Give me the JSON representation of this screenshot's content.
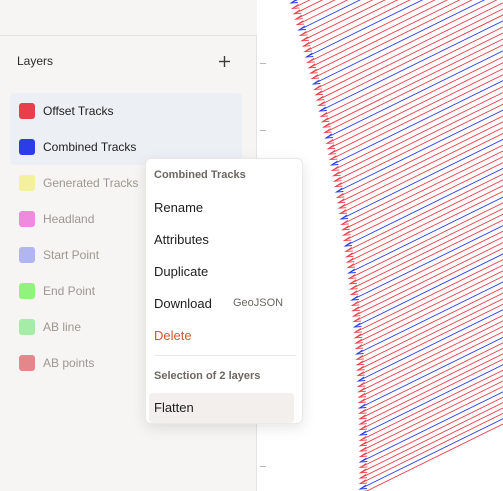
{
  "sidebar": {
    "title": "Layers",
    "add_icon": "plus-icon",
    "layers": [
      {
        "label": "Offset Tracks",
        "color": "#e8404a",
        "faded": false,
        "selected": true
      },
      {
        "label": "Combined Tracks",
        "color": "#2a3de8",
        "faded": false,
        "selected": true
      },
      {
        "label": "Generated Tracks",
        "color": "#f3f19c",
        "faded": true,
        "selected": false
      },
      {
        "label": "Headland",
        "color": "#ee8be0",
        "faded": true,
        "selected": false
      },
      {
        "label": "Start Point",
        "color": "#b1b5f1",
        "faded": true,
        "selected": false
      },
      {
        "label": "End Point",
        "color": "#92f27e",
        "faded": true,
        "selected": false
      },
      {
        "label": "AB line",
        "color": "#a5eca7",
        "faded": true,
        "selected": false
      },
      {
        "label": "AB points",
        "color": "#e3878d",
        "faded": true,
        "selected": false
      }
    ]
  },
  "context_menu": {
    "header": "Combined Tracks",
    "items": [
      {
        "label": "Rename",
        "hint": ""
      },
      {
        "label": "Attributes",
        "hint": ""
      },
      {
        "label": "Duplicate",
        "hint": ""
      },
      {
        "label": "Download",
        "hint": "GeoJSON"
      },
      {
        "label": "Delete",
        "hint": ""
      }
    ],
    "selection_header": "Selection of 2 layers",
    "selection_items": [
      {
        "label": "Flatten"
      }
    ]
  },
  "map": {
    "red_track_color": "#e8404a",
    "blue_track_color": "#2a3de8"
  }
}
